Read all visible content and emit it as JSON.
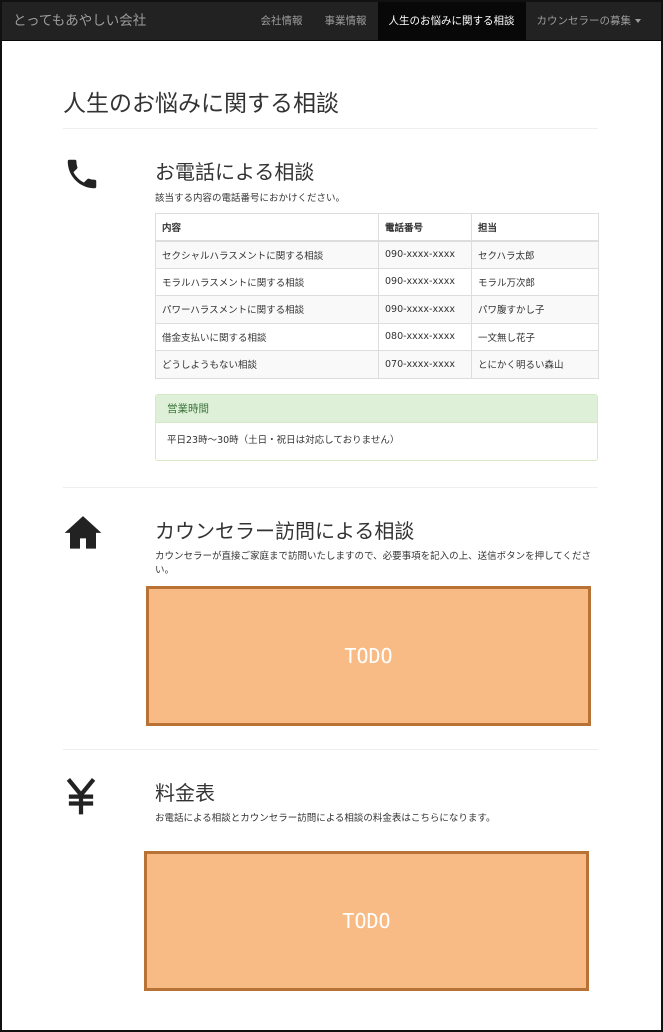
{
  "navbar": {
    "brand": "とってもあやしい会社",
    "items": [
      {
        "label": "会社情報"
      },
      {
        "label": "事業情報"
      },
      {
        "label": "人生のお悩みに関する相談"
      },
      {
        "label": "カウンセラーの募集"
      }
    ]
  },
  "page": {
    "title": "人生のお悩みに関する相談"
  },
  "phone_section": {
    "icon": "phone-icon",
    "title": "お電話による相談",
    "description": "該当する内容の電話番号におかけください。",
    "table": {
      "headers": [
        "内容",
        "電話番号",
        "担当"
      ],
      "rows": [
        [
          "セクシャルハラスメントに関する相談",
          "090-xxxx-xxxx",
          "セクハラ太郎"
        ],
        [
          "モラルハラスメントに関する相談",
          "090-xxxx-xxxx",
          "モラル万次郎"
        ],
        [
          "パワーハラスメントに関する相談",
          "090-xxxx-xxxx",
          "パワ腹すかし子"
        ],
        [
          "借金支払いに関する相談",
          "080-xxxx-xxxx",
          "一文無し花子"
        ],
        [
          "どうしようもない相談",
          "070-xxxx-xxxx",
          "とにかく明るい森山"
        ]
      ]
    },
    "hours": {
      "heading": "営業時間",
      "body": "平日23時～30時（土日・祝日は対応しておりません）"
    }
  },
  "visit_section": {
    "icon": "home-icon",
    "title": "カウンセラー訪問による相談",
    "description": "カウンセラーが直接ご家庭まで訪問いたしますので、必要事項を記入の上、送信ボタンを押してください。",
    "placeholder": "TODO"
  },
  "price_section": {
    "icon": "yen-icon",
    "title": "料金表",
    "description": "お電話による相談とカウンセラー訪問による相談の料金表はこちらになります。",
    "placeholder": "TODO"
  },
  "colors": {
    "navbar_bg": "#222222",
    "nav_active_bg": "#080808",
    "panel_heading_bg": "#dff0d8",
    "panel_heading_text": "#3c763d",
    "todo_fill": "#f8bb86",
    "todo_border": "#b97236"
  }
}
